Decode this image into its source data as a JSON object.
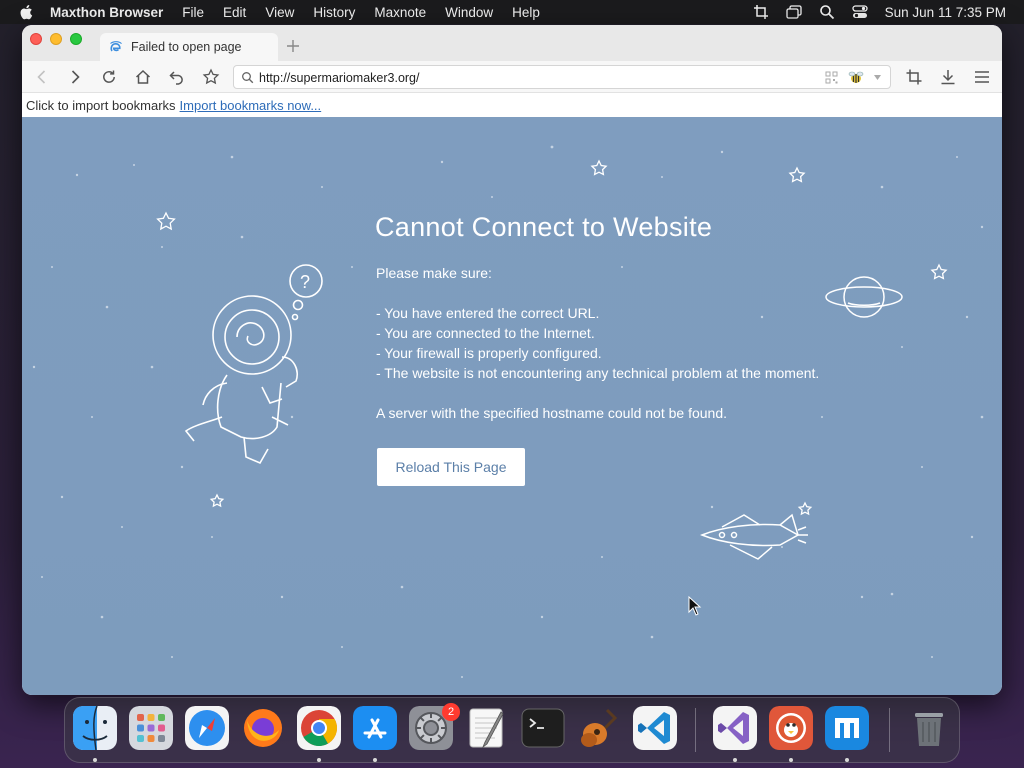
{
  "menubar": {
    "app_name": "Maxthon Browser",
    "menus": [
      "File",
      "Edit",
      "View",
      "History",
      "Maxnote",
      "Window",
      "Help"
    ],
    "clock": "Sun Jun 11  7:35 PM"
  },
  "browser": {
    "tab_title": "Failed to open page",
    "url": "http://supermariomaker3.org/",
    "bookmarks_prompt": "Click to import bookmarks",
    "bookmarks_link": "Import bookmarks now..."
  },
  "error_page": {
    "title": "Cannot Connect to Website",
    "intro": "Please make sure:",
    "checklist": [
      "- You have entered the correct URL.",
      "- You are connected to the Internet.",
      "- Your firewall is properly configured.",
      "- The website is not encountering any technical problem at the moment."
    ],
    "detail": "A server with the specified hostname could not be found.",
    "reload_button": "Reload This Page"
  },
  "dock": {
    "apps": [
      "Finder",
      "Launchpad",
      "Safari",
      "Firefox",
      "Chrome",
      "App Store",
      "System Preferences",
      "TextEdit",
      "Terminal",
      "GarageBand",
      "Visual Studio Code",
      "Visual Studio",
      "DuckDuckGo",
      "Maxthon",
      "Trash"
    ],
    "settings_badge": "2"
  },
  "colors": {
    "page_background": "#7f9dbf",
    "reload_text": "#5b7fa8",
    "link": "#2e6cb8"
  }
}
